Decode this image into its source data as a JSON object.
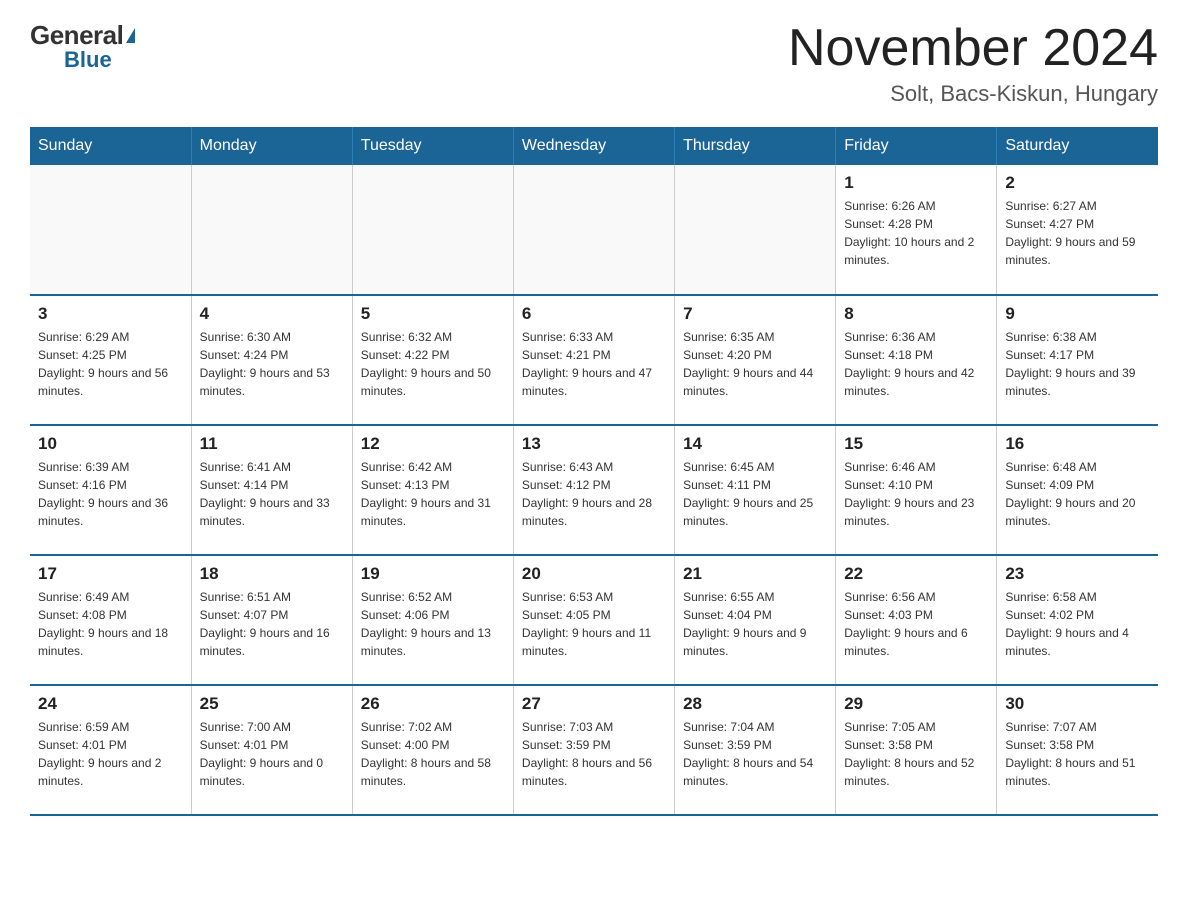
{
  "header": {
    "logo_general": "General",
    "logo_triangle": "▶",
    "logo_blue": "Blue",
    "month_title": "November 2024",
    "location": "Solt, Bacs-Kiskun, Hungary"
  },
  "days_of_week": [
    "Sunday",
    "Monday",
    "Tuesday",
    "Wednesday",
    "Thursday",
    "Friday",
    "Saturday"
  ],
  "weeks": [
    [
      {
        "day": "",
        "info": ""
      },
      {
        "day": "",
        "info": ""
      },
      {
        "day": "",
        "info": ""
      },
      {
        "day": "",
        "info": ""
      },
      {
        "day": "",
        "info": ""
      },
      {
        "day": "1",
        "info": "Sunrise: 6:26 AM\nSunset: 4:28 PM\nDaylight: 10 hours and 2 minutes."
      },
      {
        "day": "2",
        "info": "Sunrise: 6:27 AM\nSunset: 4:27 PM\nDaylight: 9 hours and 59 minutes."
      }
    ],
    [
      {
        "day": "3",
        "info": "Sunrise: 6:29 AM\nSunset: 4:25 PM\nDaylight: 9 hours and 56 minutes."
      },
      {
        "day": "4",
        "info": "Sunrise: 6:30 AM\nSunset: 4:24 PM\nDaylight: 9 hours and 53 minutes."
      },
      {
        "day": "5",
        "info": "Sunrise: 6:32 AM\nSunset: 4:22 PM\nDaylight: 9 hours and 50 minutes."
      },
      {
        "day": "6",
        "info": "Sunrise: 6:33 AM\nSunset: 4:21 PM\nDaylight: 9 hours and 47 minutes."
      },
      {
        "day": "7",
        "info": "Sunrise: 6:35 AM\nSunset: 4:20 PM\nDaylight: 9 hours and 44 minutes."
      },
      {
        "day": "8",
        "info": "Sunrise: 6:36 AM\nSunset: 4:18 PM\nDaylight: 9 hours and 42 minutes."
      },
      {
        "day": "9",
        "info": "Sunrise: 6:38 AM\nSunset: 4:17 PM\nDaylight: 9 hours and 39 minutes."
      }
    ],
    [
      {
        "day": "10",
        "info": "Sunrise: 6:39 AM\nSunset: 4:16 PM\nDaylight: 9 hours and 36 minutes."
      },
      {
        "day": "11",
        "info": "Sunrise: 6:41 AM\nSunset: 4:14 PM\nDaylight: 9 hours and 33 minutes."
      },
      {
        "day": "12",
        "info": "Sunrise: 6:42 AM\nSunset: 4:13 PM\nDaylight: 9 hours and 31 minutes."
      },
      {
        "day": "13",
        "info": "Sunrise: 6:43 AM\nSunset: 4:12 PM\nDaylight: 9 hours and 28 minutes."
      },
      {
        "day": "14",
        "info": "Sunrise: 6:45 AM\nSunset: 4:11 PM\nDaylight: 9 hours and 25 minutes."
      },
      {
        "day": "15",
        "info": "Sunrise: 6:46 AM\nSunset: 4:10 PM\nDaylight: 9 hours and 23 minutes."
      },
      {
        "day": "16",
        "info": "Sunrise: 6:48 AM\nSunset: 4:09 PM\nDaylight: 9 hours and 20 minutes."
      }
    ],
    [
      {
        "day": "17",
        "info": "Sunrise: 6:49 AM\nSunset: 4:08 PM\nDaylight: 9 hours and 18 minutes."
      },
      {
        "day": "18",
        "info": "Sunrise: 6:51 AM\nSunset: 4:07 PM\nDaylight: 9 hours and 16 minutes."
      },
      {
        "day": "19",
        "info": "Sunrise: 6:52 AM\nSunset: 4:06 PM\nDaylight: 9 hours and 13 minutes."
      },
      {
        "day": "20",
        "info": "Sunrise: 6:53 AM\nSunset: 4:05 PM\nDaylight: 9 hours and 11 minutes."
      },
      {
        "day": "21",
        "info": "Sunrise: 6:55 AM\nSunset: 4:04 PM\nDaylight: 9 hours and 9 minutes."
      },
      {
        "day": "22",
        "info": "Sunrise: 6:56 AM\nSunset: 4:03 PM\nDaylight: 9 hours and 6 minutes."
      },
      {
        "day": "23",
        "info": "Sunrise: 6:58 AM\nSunset: 4:02 PM\nDaylight: 9 hours and 4 minutes."
      }
    ],
    [
      {
        "day": "24",
        "info": "Sunrise: 6:59 AM\nSunset: 4:01 PM\nDaylight: 9 hours and 2 minutes."
      },
      {
        "day": "25",
        "info": "Sunrise: 7:00 AM\nSunset: 4:01 PM\nDaylight: 9 hours and 0 minutes."
      },
      {
        "day": "26",
        "info": "Sunrise: 7:02 AM\nSunset: 4:00 PM\nDaylight: 8 hours and 58 minutes."
      },
      {
        "day": "27",
        "info": "Sunrise: 7:03 AM\nSunset: 3:59 PM\nDaylight: 8 hours and 56 minutes."
      },
      {
        "day": "28",
        "info": "Sunrise: 7:04 AM\nSunset: 3:59 PM\nDaylight: 8 hours and 54 minutes."
      },
      {
        "day": "29",
        "info": "Sunrise: 7:05 AM\nSunset: 3:58 PM\nDaylight: 8 hours and 52 minutes."
      },
      {
        "day": "30",
        "info": "Sunrise: 7:07 AM\nSunset: 3:58 PM\nDaylight: 8 hours and 51 minutes."
      }
    ]
  ]
}
